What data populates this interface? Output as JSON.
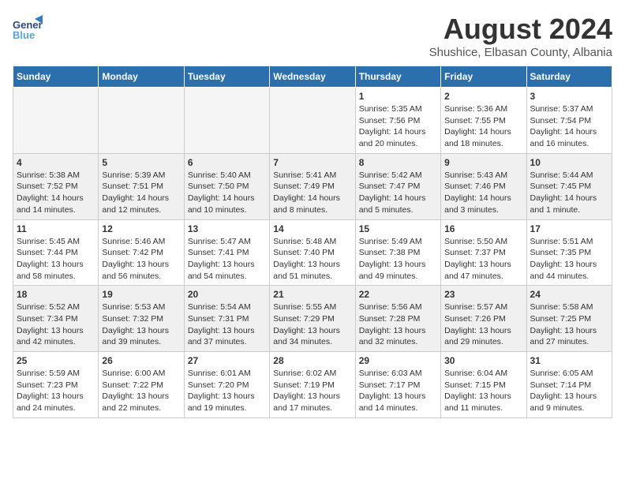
{
  "header": {
    "logo_line1": "General",
    "logo_line2": "Blue",
    "title": "August 2024",
    "subtitle": "Shushice, Elbasan County, Albania"
  },
  "weekdays": [
    "Sunday",
    "Monday",
    "Tuesday",
    "Wednesday",
    "Thursday",
    "Friday",
    "Saturday"
  ],
  "weeks": [
    [
      {
        "day": "",
        "info": "",
        "empty": true
      },
      {
        "day": "",
        "info": "",
        "empty": true
      },
      {
        "day": "",
        "info": "",
        "empty": true
      },
      {
        "day": "",
        "info": "",
        "empty": true
      },
      {
        "day": "1",
        "info": "Sunrise: 5:35 AM\nSunset: 7:56 PM\nDaylight: 14 hours\nand 20 minutes.",
        "empty": false
      },
      {
        "day": "2",
        "info": "Sunrise: 5:36 AM\nSunset: 7:55 PM\nDaylight: 14 hours\nand 18 minutes.",
        "empty": false
      },
      {
        "day": "3",
        "info": "Sunrise: 5:37 AM\nSunset: 7:54 PM\nDaylight: 14 hours\nand 16 minutes.",
        "empty": false
      }
    ],
    [
      {
        "day": "4",
        "info": "Sunrise: 5:38 AM\nSunset: 7:52 PM\nDaylight: 14 hours\nand 14 minutes.",
        "empty": false
      },
      {
        "day": "5",
        "info": "Sunrise: 5:39 AM\nSunset: 7:51 PM\nDaylight: 14 hours\nand 12 minutes.",
        "empty": false
      },
      {
        "day": "6",
        "info": "Sunrise: 5:40 AM\nSunset: 7:50 PM\nDaylight: 14 hours\nand 10 minutes.",
        "empty": false
      },
      {
        "day": "7",
        "info": "Sunrise: 5:41 AM\nSunset: 7:49 PM\nDaylight: 14 hours\nand 8 minutes.",
        "empty": false
      },
      {
        "day": "8",
        "info": "Sunrise: 5:42 AM\nSunset: 7:47 PM\nDaylight: 14 hours\nand 5 minutes.",
        "empty": false
      },
      {
        "day": "9",
        "info": "Sunrise: 5:43 AM\nSunset: 7:46 PM\nDaylight: 14 hours\nand 3 minutes.",
        "empty": false
      },
      {
        "day": "10",
        "info": "Sunrise: 5:44 AM\nSunset: 7:45 PM\nDaylight: 14 hours\nand 1 minute.",
        "empty": false
      }
    ],
    [
      {
        "day": "11",
        "info": "Sunrise: 5:45 AM\nSunset: 7:44 PM\nDaylight: 13 hours\nand 58 minutes.",
        "empty": false
      },
      {
        "day": "12",
        "info": "Sunrise: 5:46 AM\nSunset: 7:42 PM\nDaylight: 13 hours\nand 56 minutes.",
        "empty": false
      },
      {
        "day": "13",
        "info": "Sunrise: 5:47 AM\nSunset: 7:41 PM\nDaylight: 13 hours\nand 54 minutes.",
        "empty": false
      },
      {
        "day": "14",
        "info": "Sunrise: 5:48 AM\nSunset: 7:40 PM\nDaylight: 13 hours\nand 51 minutes.",
        "empty": false
      },
      {
        "day": "15",
        "info": "Sunrise: 5:49 AM\nSunset: 7:38 PM\nDaylight: 13 hours\nand 49 minutes.",
        "empty": false
      },
      {
        "day": "16",
        "info": "Sunrise: 5:50 AM\nSunset: 7:37 PM\nDaylight: 13 hours\nand 47 minutes.",
        "empty": false
      },
      {
        "day": "17",
        "info": "Sunrise: 5:51 AM\nSunset: 7:35 PM\nDaylight: 13 hours\nand 44 minutes.",
        "empty": false
      }
    ],
    [
      {
        "day": "18",
        "info": "Sunrise: 5:52 AM\nSunset: 7:34 PM\nDaylight: 13 hours\nand 42 minutes.",
        "empty": false
      },
      {
        "day": "19",
        "info": "Sunrise: 5:53 AM\nSunset: 7:32 PM\nDaylight: 13 hours\nand 39 minutes.",
        "empty": false
      },
      {
        "day": "20",
        "info": "Sunrise: 5:54 AM\nSunset: 7:31 PM\nDaylight: 13 hours\nand 37 minutes.",
        "empty": false
      },
      {
        "day": "21",
        "info": "Sunrise: 5:55 AM\nSunset: 7:29 PM\nDaylight: 13 hours\nand 34 minutes.",
        "empty": false
      },
      {
        "day": "22",
        "info": "Sunrise: 5:56 AM\nSunset: 7:28 PM\nDaylight: 13 hours\nand 32 minutes.",
        "empty": false
      },
      {
        "day": "23",
        "info": "Sunrise: 5:57 AM\nSunset: 7:26 PM\nDaylight: 13 hours\nand 29 minutes.",
        "empty": false
      },
      {
        "day": "24",
        "info": "Sunrise: 5:58 AM\nSunset: 7:25 PM\nDaylight: 13 hours\nand 27 minutes.",
        "empty": false
      }
    ],
    [
      {
        "day": "25",
        "info": "Sunrise: 5:59 AM\nSunset: 7:23 PM\nDaylight: 13 hours\nand 24 minutes.",
        "empty": false
      },
      {
        "day": "26",
        "info": "Sunrise: 6:00 AM\nSunset: 7:22 PM\nDaylight: 13 hours\nand 22 minutes.",
        "empty": false
      },
      {
        "day": "27",
        "info": "Sunrise: 6:01 AM\nSunset: 7:20 PM\nDaylight: 13 hours\nand 19 minutes.",
        "empty": false
      },
      {
        "day": "28",
        "info": "Sunrise: 6:02 AM\nSunset: 7:19 PM\nDaylight: 13 hours\nand 17 minutes.",
        "empty": false
      },
      {
        "day": "29",
        "info": "Sunrise: 6:03 AM\nSunset: 7:17 PM\nDaylight: 13 hours\nand 14 minutes.",
        "empty": false
      },
      {
        "day": "30",
        "info": "Sunrise: 6:04 AM\nSunset: 7:15 PM\nDaylight: 13 hours\nand 11 minutes.",
        "empty": false
      },
      {
        "day": "31",
        "info": "Sunrise: 6:05 AM\nSunset: 7:14 PM\nDaylight: 13 hours\nand 9 minutes.",
        "empty": false
      }
    ]
  ]
}
